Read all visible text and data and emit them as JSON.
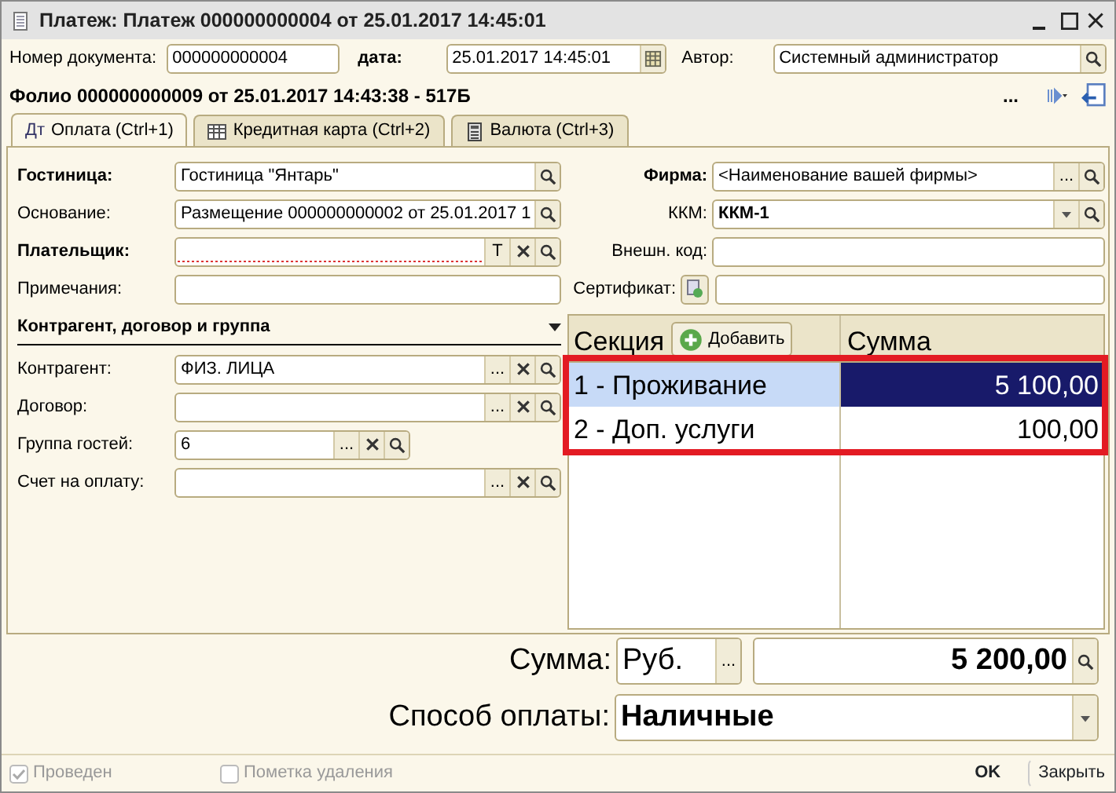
{
  "window": {
    "title": "Платеж: Платеж 000000000004 от 25.01.2017 14:45:01"
  },
  "header": {
    "doc_number": {
      "label": "Номер документа:",
      "value": "000000000004"
    },
    "date": {
      "label": "дата:",
      "value": "25.01.2017 14:45:01"
    },
    "author": {
      "label": "Автор:",
      "value": "Системный администратор"
    }
  },
  "folio": "Фолио 000000000009 от 25.01.2017 14:43:38 - 517Б",
  "toolbar": {
    "more": "..."
  },
  "tabs": [
    {
      "label": "Оплата (Ctrl+1)",
      "icon_text": "Дт",
      "selected": true
    },
    {
      "label": "Кредитная карта (Ctrl+2)",
      "selected": false
    },
    {
      "label": "Валюта (Ctrl+3)",
      "selected": false
    }
  ],
  "left_fields": [
    {
      "label": "Гостиница:",
      "bold": true,
      "value": "Гостиница \"Янтарь\"",
      "required": false,
      "buttons": [
        {
          "kind": "search"
        }
      ]
    },
    {
      "label": "Основание:",
      "bold": false,
      "value": "Размещение 000000000002 от 25.01.2017 1",
      "required": false,
      "buttons": [
        {
          "kind": "search"
        }
      ]
    },
    {
      "label": "Плательщик:",
      "bold": true,
      "required": true,
      "buttons": [
        {
          "kind": "text",
          "text": "T"
        },
        {
          "kind": "clear"
        },
        {
          "kind": "search"
        }
      ]
    },
    {
      "label": "Примечания:",
      "bold": false,
      "required": false
    }
  ],
  "section": {
    "title": "Контрагент, договор и группа",
    "expanded": true
  },
  "section_fields": [
    {
      "label": "Контрагент:",
      "value": "ФИЗ. ЛИЦА",
      "narrow": false,
      "buttons": [
        {
          "kind": "text",
          "text": "..."
        },
        {
          "kind": "clear"
        },
        {
          "kind": "search"
        }
      ]
    },
    {
      "label": "Договор:",
      "narrow": false,
      "buttons": [
        {
          "kind": "text",
          "text": "..."
        },
        {
          "kind": "clear"
        },
        {
          "kind": "search"
        }
      ]
    },
    {
      "label": "Группа гостей:",
      "value": "6",
      "narrow": true,
      "buttons": [
        {
          "kind": "text",
          "text": "..."
        },
        {
          "kind": "clear"
        },
        {
          "kind": "search"
        }
      ]
    },
    {
      "label": "Счет на оплату:",
      "narrow": false,
      "buttons": [
        {
          "kind": "text",
          "text": "..."
        },
        {
          "kind": "clear"
        },
        {
          "kind": "search"
        }
      ]
    }
  ],
  "right_fields": [
    {
      "kind": "plain",
      "label": "Фирма:",
      "bold": true,
      "value": "<Наименование вашей фирмы>",
      "value_bold": false,
      "buttons": [
        {
          "kind": "text",
          "text": "..."
        },
        {
          "kind": "search"
        }
      ]
    },
    {
      "kind": "plain",
      "label": "ККМ:",
      "bold": false,
      "value": "ККМ-1",
      "value_bold": true,
      "buttons": [
        {
          "kind": "dropdown"
        },
        {
          "kind": "search"
        }
      ]
    },
    {
      "kind": "plain",
      "label": "Внешн. код:",
      "bold": false
    },
    {
      "kind": "certificate",
      "label": "Сертификат:",
      "bold": false
    }
  ],
  "table": {
    "columns": [
      "Секция",
      "Сумма"
    ],
    "add_button": "Добавить",
    "rows": [
      {
        "section": "1 - Проживание",
        "amount": "5 100,00",
        "selected": true
      },
      {
        "section": "2 - Доп. услуги",
        "amount": "100,00",
        "selected": false
      }
    ]
  },
  "totals": {
    "sum_label": "Сумма:",
    "currency": "Руб.",
    "currency_button": "...",
    "total": "5 200,00",
    "payment_label": "Способ оплаты:",
    "payment": "Наличные"
  },
  "footer": {
    "posted": {
      "label": "Проведен",
      "checked": true,
      "disabled": true
    },
    "deletion_mark": {
      "label": "Пометка удаления",
      "checked": false,
      "disabled": true
    },
    "ok": "OK",
    "close": "Закрыть"
  }
}
